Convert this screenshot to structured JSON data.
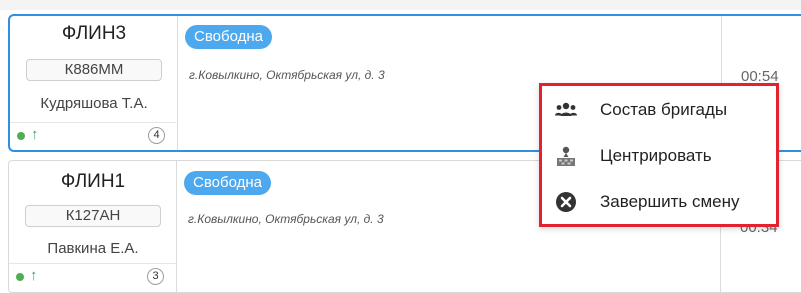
{
  "units": [
    {
      "callsign": "ФЛИН3",
      "plate": "К886ММ",
      "person": "Кудряшова Т.А.",
      "status": "Свободна",
      "address": "г.Ковылкино, Октябрьская ул, д. 3",
      "time": "00:54",
      "count": "4"
    },
    {
      "callsign": "ФЛИН1",
      "plate": "К127АН",
      "person": "Павкина Е.А.",
      "status": "Свободна",
      "address": "г.Ковылкино, Октябрьская ул, д. 3",
      "time": "00:34",
      "count": "3"
    }
  ],
  "context_menu": {
    "items": [
      {
        "label": "Состав бригады",
        "icon": "team-icon"
      },
      {
        "label": "Центрировать",
        "icon": "center-map-icon"
      },
      {
        "label": "Завершить смену",
        "icon": "close-circle-icon"
      }
    ]
  },
  "colors": {
    "selected_border": "#2f8fe0",
    "status_badge": "#4da8ee",
    "menu_highlight_border": "#e3222f",
    "online_dot": "#4caf50"
  }
}
